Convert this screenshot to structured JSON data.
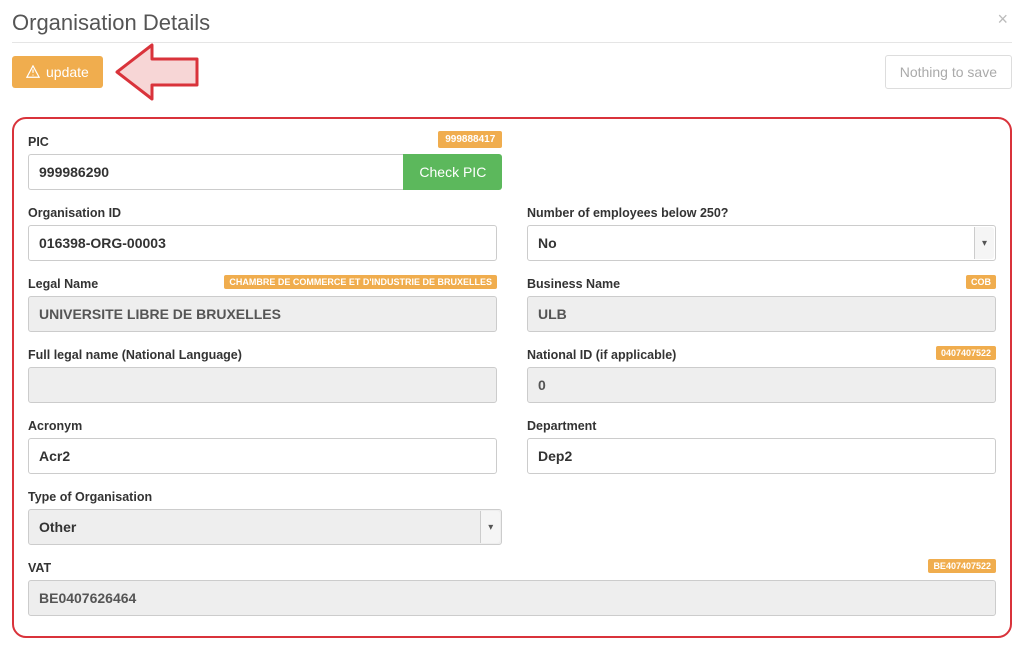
{
  "header": {
    "title": "Organisation Details"
  },
  "actions": {
    "update_label": "update",
    "nothing_label": "Nothing to save"
  },
  "pic": {
    "label": "PIC",
    "value": "999986290",
    "valid_badge": "999888417",
    "check_label": "Check PIC"
  },
  "org_id": {
    "label": "Organisation ID",
    "value": "016398-ORG-00003"
  },
  "employees": {
    "label": "Number of employees below 250?",
    "value": "No"
  },
  "legal_name": {
    "label": "Legal Name",
    "value": "UNIVERSITE LIBRE DE BRUXELLES",
    "badge": "CHAMBRE DE COMMERCE ET D'INDUSTRIE DE BRUXELLES"
  },
  "business_name": {
    "label": "Business Name",
    "value": "ULB",
    "badge": "COB"
  },
  "full_legal": {
    "label": "Full legal name (National Language)",
    "value": ""
  },
  "national_id": {
    "label": "National ID (if applicable)",
    "value": "0",
    "badge": "0407407522"
  },
  "acronym": {
    "label": "Acronym",
    "value": "Acr2"
  },
  "department": {
    "label": "Department",
    "value": "Dep2"
  },
  "org_type": {
    "label": "Type of Organisation",
    "value": "Other"
  },
  "vat": {
    "label": "VAT",
    "value": "BE0407626464",
    "badge": "BE407407522"
  }
}
